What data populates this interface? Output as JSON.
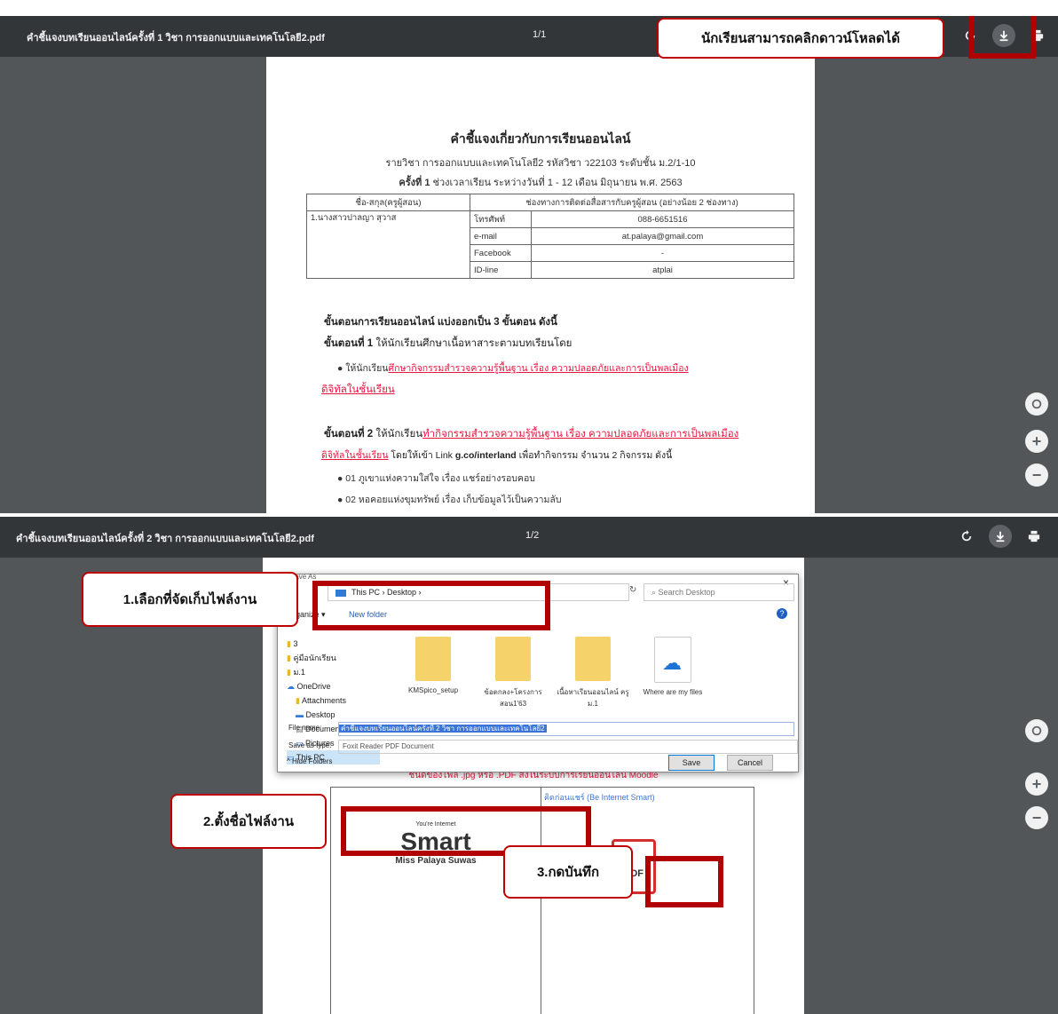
{
  "viewer1": {
    "filename": "คำชี้แจงบทเรียนออนไลน์ครั้งที่ 1 วิชา การออกแบบและเทคโนโลยี2.pdf",
    "page_indicator": "1/1",
    "annotation": "นักเรียนสามารถคลิกดาวน์โหลดได้",
    "doc": {
      "title": "คำชี้แจงเกี่ยวกับการเรียนออนไลน์",
      "course_line": "รายวิชา  การออกแบบและเทคโนโลยี2 รหัสวิชา ว22103  ระดับชั้น ม.2/1-10",
      "session_bold": "ครั้งที่ 1",
      "session_rest": "ช่วงเวลาเรียน  ระหว่างวันที่  1 - 12   เดือน  มิถุนายน  พ.ศ. 2563",
      "table": {
        "head1": "ชื่อ-สกุล(ครูผู้สอน)",
        "head2": "ช่องทางการติดต่อสื่อสารกับครูผู้สอน (อย่างน้อย 2 ช่องทาง)",
        "teacher": "1.นางสาวปาลญา สุวาส",
        "rows": [
          {
            "label": "โทรศัพท์",
            "value": "088-6651516"
          },
          {
            "label": "e-mail",
            "value": "at.palaya@gmail.com"
          },
          {
            "label": "Facebook",
            "value": "-"
          },
          {
            "label": "ID-line",
            "value": "atplai"
          }
        ]
      },
      "steps_heading": "ขั้นตอนการเรียนออนไลน์ แบ่งออกเป็น 3 ขั้นตอน ดังนี้",
      "step1_bold": "ขั้นตอนที่ 1",
      "step1_text": " ให้นักเรียนศึกษาเนื้อหาสาระตามบทเรียนโดย",
      "step1_bullet_prefix": "ให้นักเรียน",
      "step1_bullet_link": "ศึกษากิจกรรมสำรวจความรู้พื้นฐาน เรื่อง ความปลอดภัยและการเป็นพลเมือง",
      "step1_bullet_link2": "ดิจิทัลในชั้นเรียน",
      "step2_bold": "ขั้นตอนที่ 2",
      "step2_text": " ให้นักเรียน",
      "step2_link": "ทำกิจกรรมสำรวจความรู้พื้นฐาน เรื่อง ความปลอดภัยและการเป็นพลเมือง",
      "step2_link2": "ดิจิทัลในชั้นเรียน",
      "step2_tail_pre": " โดยให้เข้า Link ",
      "step2_url": "g.co/interland",
      "step2_tail": " เพื่อทำกิจกรรม จำนวน 2 กิจกรรม ดังนี้",
      "bullet_a": "01 ภูเขาแห่งความใส่ใจ เรื่อง แชร์อย่างรอบคอบ",
      "bullet_b": "02 หอคอยแห่งขุมทรัพย์ เรื่อง เก็บข้อมูลไว้เป็นความลับ"
    }
  },
  "viewer2": {
    "filename": "คำชี้แจงบทเรียนออนไลน์ครั้งที่ 2 วิชา การออกแบบและเทคโนโลยี2.pdf",
    "page_indicator": "1/2",
    "annotation_1": "1.เลือกที่จัดเก็บไฟล์งาน",
    "annotation_2": "2.ตั้งชื่อไฟล์งาน",
    "annotation_3": "3.กดบันทึก",
    "dialog": {
      "title": "Save As",
      "path": "This PC  ›  Desktop  ›",
      "search_placeholder": "Search Desktop",
      "organize": "Organize ▾",
      "new_folder": "New folder",
      "nav_items": [
        "3",
        "คู่มือนักเรียน",
        "ม.1",
        "OneDrive",
        "Attachments",
        "Desktop",
        "Documents",
        "Pictures",
        "This PC"
      ],
      "files": [
        "KMSpico_setup",
        "ข้อตกลง+โครงการสอน1'63",
        "เนื้อหาเรียนออนไลน์ ครู ม.1",
        "Where are my files"
      ],
      "filename_label": "File name:",
      "filename_value": "คำชี้แจงบทเรียนออนไลน์ครั้งที่ 2 วิชา การออกแบบและเทคโนโลยี2",
      "savetype_label": "Save as type:",
      "savetype_value": "Foxit Reader PDF Document",
      "hide_folders": "Hide Folders",
      "save": "Save",
      "cancel": "Cancel"
    },
    "below": {
      "filetype_note": "ชนิดของไฟล์  .jpg หรือ .PDF  ส่งในระบบการเรียนออนไลน์ Moodle",
      "card_right_title": "คิดก่อนแชร์ (Be Internet Smart)",
      "smart_small": "You're Internet",
      "smart_big": "Smart",
      "smart_name": "Miss Palaya Suwas",
      "pdf_label": "PDF"
    }
  }
}
